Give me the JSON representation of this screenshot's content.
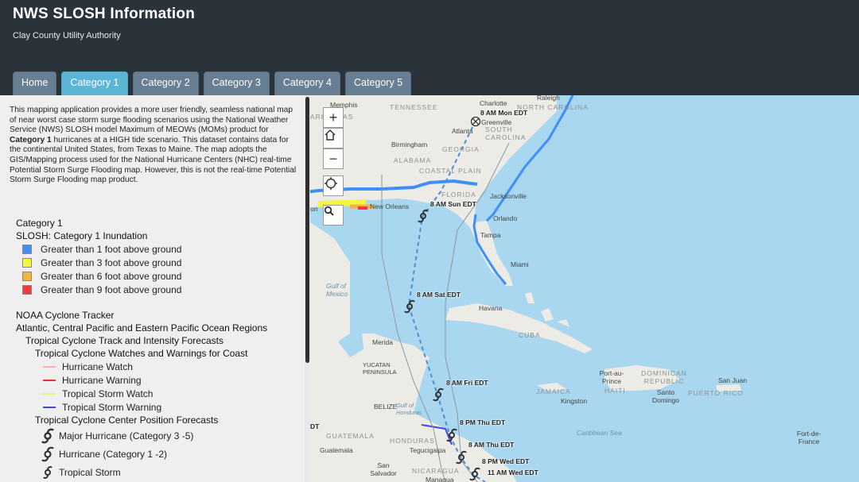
{
  "header": {
    "title": "NWS SLOSH Information",
    "subtitle": "Clay County Utility Authority"
  },
  "tabs": [
    {
      "label": "Home",
      "active": false
    },
    {
      "label": "Category 1",
      "active": true
    },
    {
      "label": "Category 2",
      "active": false
    },
    {
      "label": "Category 3",
      "active": false
    },
    {
      "label": "Category 4",
      "active": false
    },
    {
      "label": "Category 5",
      "active": false
    }
  ],
  "panel": {
    "intro_part1": "This mapping application provides a more user friendly, seamless national map of near worst case storm surge flooding scenarios using the National Weather Service (NWS) SLOSH model Maximum of MEOWs (MOMs) product for ",
    "intro_bold": "Category 1",
    "intro_part2": " hurricanes at a HIGH tide scenario. This dataset contains data for the continental United States, from Texas to Maine. The map adopts the GIS/Mapping process used for the National Hurricane Centers (NHC) real-time Potential Storm Surge Flooding map. However, this is not the real-time Potential Storm Surge Flooding map product.",
    "legend": {
      "layer1_title": "Category 1",
      "layer1_sub": "SLOSH: Category 1 Inundation",
      "inundation": [
        {
          "label": "Greater than 1 foot above ground",
          "color": "#3f8ff5"
        },
        {
          "label": "Greater than 3 foot above ground",
          "color": "#f5f53c"
        },
        {
          "label": "Greater than 6 foot above ground",
          "color": "#f5b43c"
        },
        {
          "label": "Greater than 9 foot above ground",
          "color": "#ee3b3b"
        }
      ],
      "layer2_title": "NOAA Cyclone Tracker",
      "layer2_sub": "Atlantic, Central Pacific and Eastern Pacific Ocean Regions",
      "layer2_sub2": "Tropical Cyclone Track and Intensity Forecasts",
      "layer2_sub3": "Tropical Cyclone Watches and Warnings for Coast",
      "watches": [
        {
          "label": "Hurricane Watch",
          "color": "#f7b1b1"
        },
        {
          "label": "Hurricane Warning",
          "color": "#ee3030"
        },
        {
          "label": "Tropical Storm Watch",
          "color": "#f6f16b"
        },
        {
          "label": "Tropical Storm Warning",
          "color": "#4747e0"
        }
      ],
      "layer2_sub4": "Tropical Cyclone Center Position Forecasts",
      "positions": [
        {
          "label": "Major Hurricane (Category 3 -5)"
        },
        {
          "label": "Hurricane (Category 1 -2)"
        },
        {
          "label": "Tropical Storm"
        }
      ]
    }
  },
  "map": {
    "controls": {
      "zoom_in": "+",
      "home": "home-icon",
      "zoom_out": "−",
      "locate": "locate-icon",
      "search": "search-icon"
    },
    "places": {
      "memphis": "Memphis",
      "tennessee": "TENNESSEE",
      "charlotte": "Charlotte",
      "raleigh": "Raleigh",
      "north_carolina": "NORTH CAROLINA",
      "greenville": "Greenville",
      "south_carolina": "SOUTH CAROLINA",
      "atlanta": "Atlanta",
      "birmingham": "Birmingham",
      "georgia": "GEORGIA",
      "alabama": "ALABAMA",
      "coastal_plain": "COASTAL PLAIN",
      "florida": "FLORIDA",
      "jacksonville": "Jacksonville",
      "new_orleans": "New Orleans",
      "orlando": "Orlando",
      "tampa": "Tampa",
      "miami": "Miami",
      "gulf_of_mexico": "Gulf of\nMexico",
      "havana": "Havana",
      "cuba": "CUBA",
      "merida": "Merida",
      "yucatan": "YUCATAN\nPENINSULA",
      "belize": "BELIZE",
      "gulf_of_honduras": "Gulf of\nHonduras",
      "guatemala": "GUATEMALA",
      "honduras": "HONDURAS",
      "tegucigalpa": "Tegucigalpa",
      "guatemala_city": "Guatemala",
      "san_salvador": "San\nSalvador",
      "nicaragua": "NICARAGUA",
      "managua": "Managua",
      "jamaica": "JAMAICA",
      "kingston": "Kingston",
      "haiti": "HAITI",
      "port_au_prince": "Port-au-\nPrince",
      "dominican_republic": "DOMINICAN\nREPUBLIC",
      "santo_domingo": "Santo\nDomingo",
      "san_juan": "San Juan",
      "puerto_rico": "PUERTO RICO",
      "caribbean_sea": "Caribbean Sea",
      "fort_de_france": "Fort-de-\nFrance",
      "arkansas": "ARKANSAS",
      "orleans_left": "on"
    },
    "forecast_times": {
      "t1": "8 AM Mon EDT",
      "t2": "8 AM Sun EDT",
      "t3": "8 AM Sat EDT",
      "t4": "8 AM Fri EDT",
      "t5": "8 PM Thu EDT",
      "t6": "8 AM Thu EDT",
      "t7": "8 PM Wed EDT",
      "t8": "11 AM Wed EDT",
      "t9": "DT"
    }
  }
}
